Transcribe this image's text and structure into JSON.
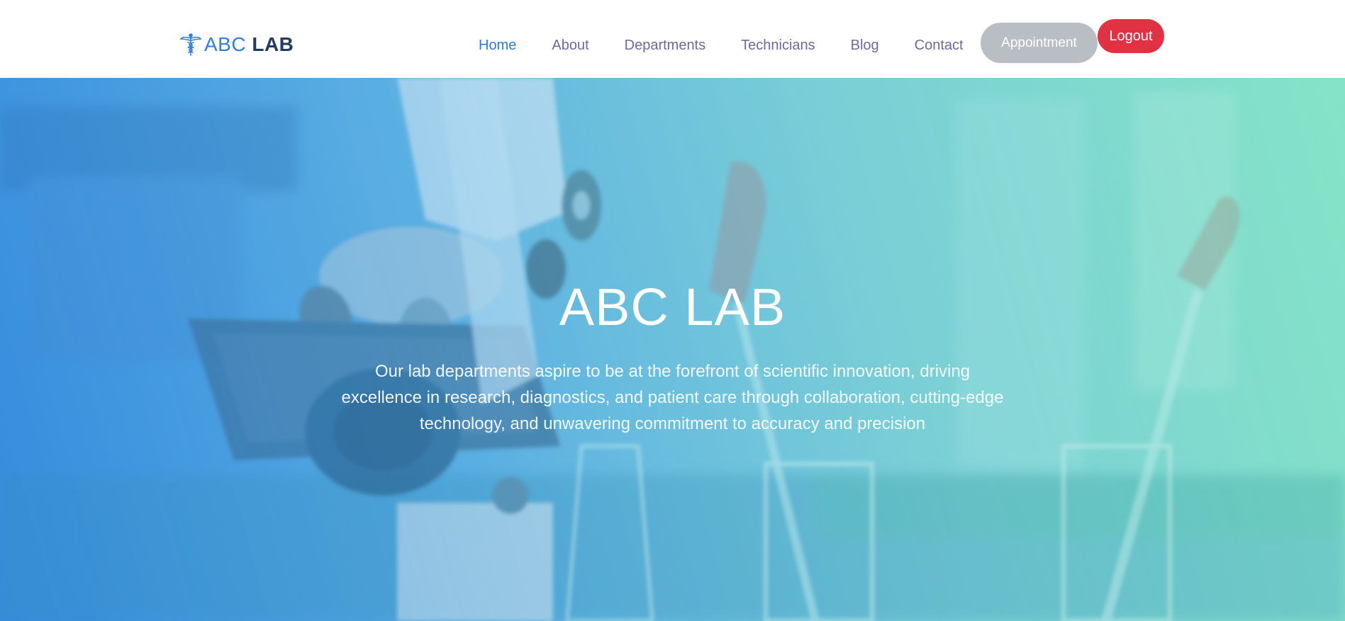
{
  "brand": {
    "name_light": "ABC",
    "name_bold": "LAB",
    "icon": "caduceus-icon",
    "color": "#2f80d9"
  },
  "nav": {
    "items": [
      {
        "label": "Home",
        "active": true
      },
      {
        "label": "About",
        "active": false
      },
      {
        "label": "Departments",
        "active": false
      },
      {
        "label": "Technicians",
        "active": false
      },
      {
        "label": "Blog",
        "active": false
      },
      {
        "label": "Contact",
        "active": false
      }
    ],
    "active_color": "#2a7fd4",
    "link_color": "#6c6a9e"
  },
  "buttons": {
    "appointment": "Appointment",
    "logout": "Logout",
    "logout_color": "#e03243"
  },
  "hero": {
    "title": "ABC LAB",
    "text": "Our lab departments aspire to be at the forefront of scientific innovation, driving excellence in research, diagnostics, and patient care through collaboration, cutting-edge technology, and unwavering commitment to accuracy and precision"
  }
}
